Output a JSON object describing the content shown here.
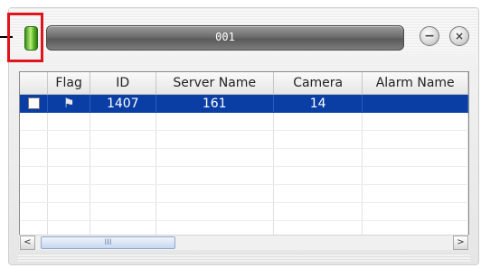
{
  "window": {
    "title": "001",
    "minimize_icon": "−",
    "close_icon": "×"
  },
  "table": {
    "columns": [
      "",
      "Flag",
      "ID",
      "Server Name",
      "Camera",
      "Alarm Name"
    ],
    "rows": [
      {
        "selected": true,
        "flag_icon": "flag-icon",
        "id": "1407",
        "server_name": "161",
        "camera": "14",
        "alarm_name": ""
      }
    ],
    "empty_rows": 7
  },
  "scrollbar": {
    "left_arrow": "<",
    "right_arrow": ">",
    "thumb_grip": "III"
  },
  "colors": {
    "selection": "#0a3ea4",
    "highlight_box": "#e0141c",
    "status_led": "#5fb82e"
  }
}
